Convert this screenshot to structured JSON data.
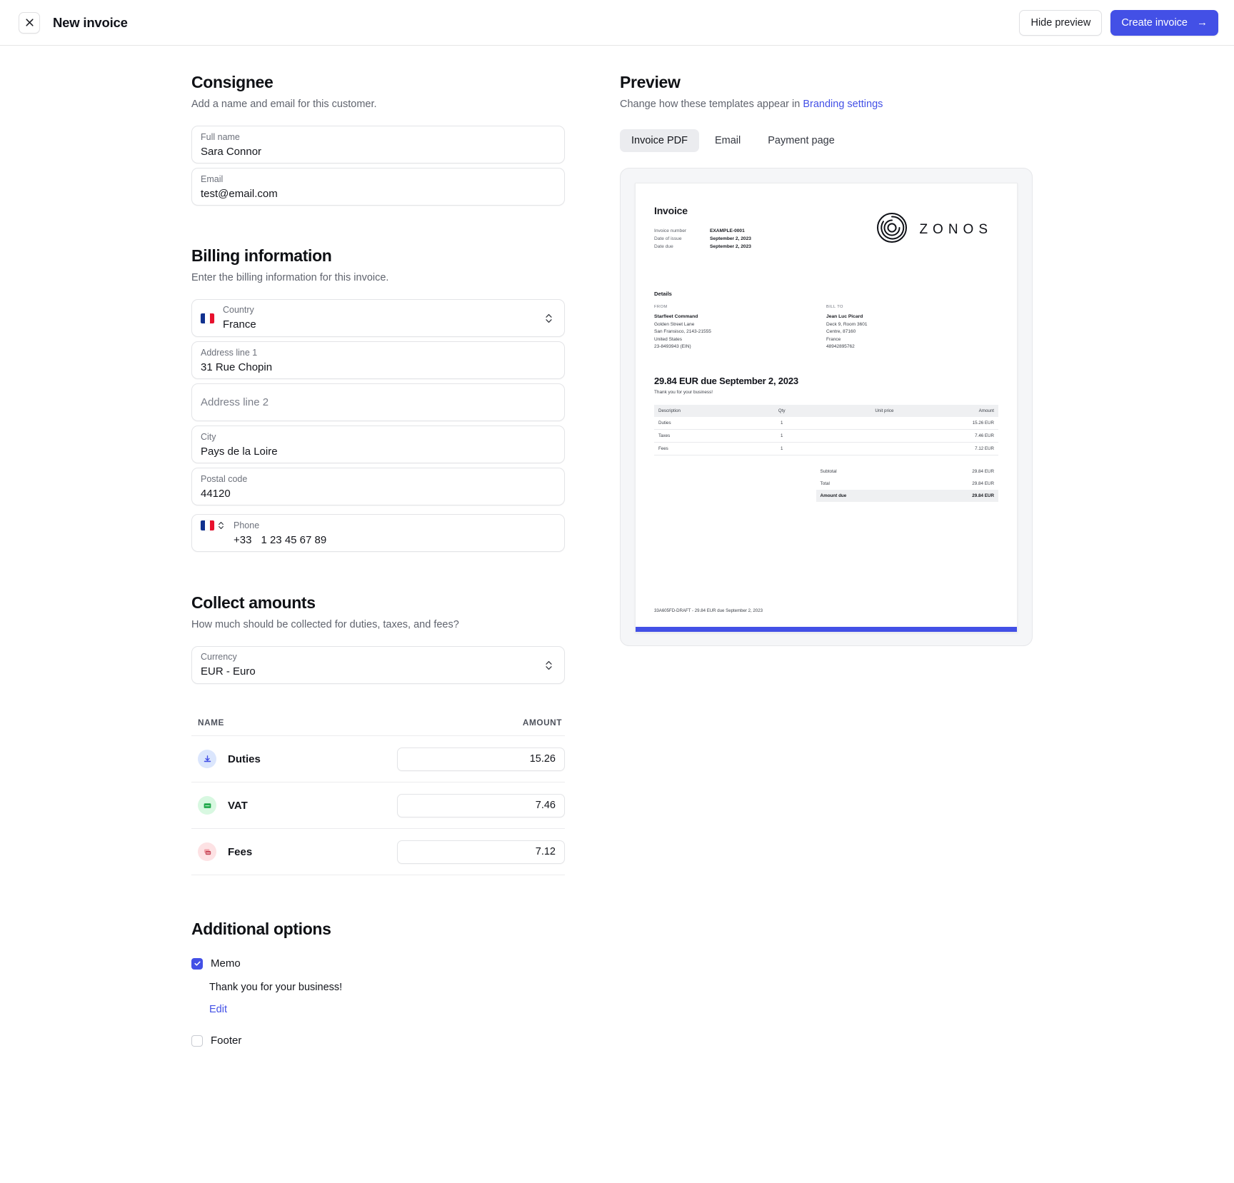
{
  "topbar": {
    "close_icon": "close-icon",
    "title": "New invoice",
    "hide_preview_label": "Hide preview",
    "create_invoice_label": "Create invoice",
    "create_invoice_arrow": "→",
    "primary_color": "#4350e6"
  },
  "consignee": {
    "title": "Consignee",
    "subtitle": "Add a name and email for this customer.",
    "fields": [
      {
        "label": "Full name",
        "value": "Sara Connor"
      },
      {
        "label": "Email",
        "value": "test@email.com"
      }
    ]
  },
  "billing": {
    "title": "Billing information",
    "subtitle": "Enter the billing information for this invoice.",
    "country": {
      "label": "Country",
      "value": "France",
      "flag": "fr-flag-icon"
    },
    "address_line_1": {
      "label": "Address line 1",
      "value": "31 Rue Chopin"
    },
    "address_line_2": {
      "placeholder": "Address line 2",
      "value": ""
    },
    "city": {
      "label": "City",
      "value": "Pays de la Loire"
    },
    "postal_code": {
      "label": "Postal code",
      "value": "44120"
    },
    "phone": {
      "label": "Phone",
      "code": "+33",
      "value": "1 23 45 67 89",
      "flag": "fr-flag-icon"
    }
  },
  "collect": {
    "title": "Collect amounts",
    "subtitle": "How much should be collected for duties, taxes, and fees?",
    "currency": {
      "label": "Currency",
      "value": "EUR - Euro"
    },
    "columns": {
      "name": "NAME",
      "amount": "AMOUNT"
    },
    "rows": [
      {
        "name": "Duties",
        "amount": "15.26",
        "icon": "duties-tray-arrow-icon",
        "icon_bg": "#dbe6fd",
        "icon_fg": "#4350e6"
      },
      {
        "name": "VAT",
        "amount": "7.46",
        "icon": "vat-receipt-icon",
        "icon_bg": "#d8f8e1",
        "icon_fg": "#22a94c"
      },
      {
        "name": "Fees",
        "amount": "7.12",
        "icon": "fees-stack-icon",
        "icon_bg": "#fde2e4",
        "icon_fg": "#e0606c"
      }
    ]
  },
  "additional": {
    "title": "Additional options",
    "memo": {
      "label": "Memo",
      "checked": true,
      "text": "Thank you for your business!",
      "edit_label": "Edit"
    },
    "footer": {
      "label": "Footer",
      "checked": false
    }
  },
  "preview": {
    "title": "Preview",
    "subtitle_prefix": "Change how these templates appear in ",
    "subtitle_link": "Branding settings",
    "tabs": [
      {
        "label": "Invoice PDF",
        "active": true
      },
      {
        "label": "Email",
        "active": false
      },
      {
        "label": "Payment page",
        "active": false
      }
    ]
  },
  "invoice_doc": {
    "heading": "Invoice",
    "meta": [
      {
        "key": "Invoice number",
        "value": "EXAMPLE-0001"
      },
      {
        "key": "Date of issue",
        "value": "September 2, 2023"
      },
      {
        "key": "Date due",
        "value": "September 2, 2023"
      }
    ],
    "brand": {
      "wordmark": "ZONOS",
      "logo_icon": "zonos-spiral-logo-icon"
    },
    "details_label": "Details",
    "from": {
      "kicker": "FROM",
      "name": "Starfleet Command",
      "lines": [
        "Golden Street Lane",
        "San Fransisco, 2143-21555",
        "United States",
        "23-8493943 (EIN)"
      ]
    },
    "bill_to": {
      "kicker": "BILL TO",
      "name": "Jean Luc Picard",
      "lines": [
        "Deck 9, Room 3601",
        "Centre, 87160",
        "France",
        "48942895762"
      ]
    },
    "due_line": "29.84 EUR due September 2, 2023",
    "due_sub": "Thank you for your business!",
    "table": {
      "columns": [
        "Description",
        "Qty",
        "Unit price",
        "Amount"
      ],
      "rows": [
        {
          "description": "Duties",
          "qty": "1",
          "unit_price": "",
          "amount": "15.26 EUR"
        },
        {
          "description": "Taxes",
          "qty": "1",
          "unit_price": "",
          "amount": "7.46 EUR"
        },
        {
          "description": "Fees",
          "qty": "1",
          "unit_price": "",
          "amount": "7.12 EUR"
        }
      ]
    },
    "totals": [
      {
        "label": "Subtotal",
        "value": "29.84 EUR",
        "emphasis": false
      },
      {
        "label": "Total",
        "value": "29.84 EUR",
        "emphasis": false
      },
      {
        "label": "Amount due",
        "value": "29.84 EUR",
        "emphasis": true
      }
    ],
    "footer": "33A605FD-DRAFT - 29.84 EUR due September 2, 2023",
    "accent_color": "#4350e6"
  }
}
